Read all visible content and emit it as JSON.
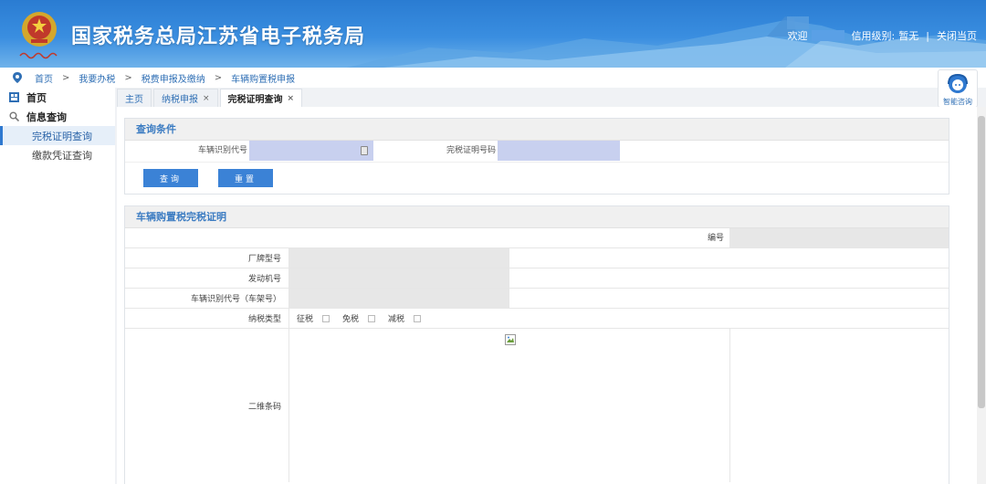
{
  "header": {
    "title": "国家税务总局江苏省电子税务局",
    "welcome": "欢迎",
    "credit_label": "信用级别:",
    "credit_value": "暂无",
    "separator": "|",
    "close_label": "关闭当页"
  },
  "breadcrumb": [
    "首页",
    "我要办税",
    "税费申报及缴纳",
    "车辆购置税申报"
  ],
  "breadcrumb_arrow": ">",
  "help": {
    "label": "智能咨询"
  },
  "sidebar": {
    "home": "首页",
    "group": "信息查询",
    "items": [
      {
        "label": "完税证明查询",
        "active": true
      },
      {
        "label": "缴款凭证查询",
        "active": false
      }
    ]
  },
  "tabs": [
    {
      "label": "主页",
      "closable": false,
      "active": false
    },
    {
      "label": "纳税申报",
      "closable": true,
      "active": false
    },
    {
      "label": "完税证明查询",
      "closable": true,
      "active": true
    }
  ],
  "close_glyph": "×",
  "query": {
    "title": "查询条件",
    "vin_label": "车辆识别代号",
    "vin_value": "",
    "cert_label": "完税证明号码",
    "cert_value": "",
    "search_btn": "查询",
    "reset_btn": "重置"
  },
  "certificate": {
    "title": "车辆购置税完税证明",
    "number_label": "编号",
    "rows": [
      {
        "label": "厂牌型号"
      },
      {
        "label": "发动机号"
      },
      {
        "label": "车辆识别代号（车架号）"
      }
    ],
    "tax_type_label": "纳税类型",
    "tax_types": [
      "征税",
      "免税",
      "减税"
    ],
    "qr_label": "二维条码"
  },
  "colors": {
    "header_blue": "#2a7cd2",
    "accent": "#3b82d6",
    "input_fill": "#c8d0ef"
  }
}
